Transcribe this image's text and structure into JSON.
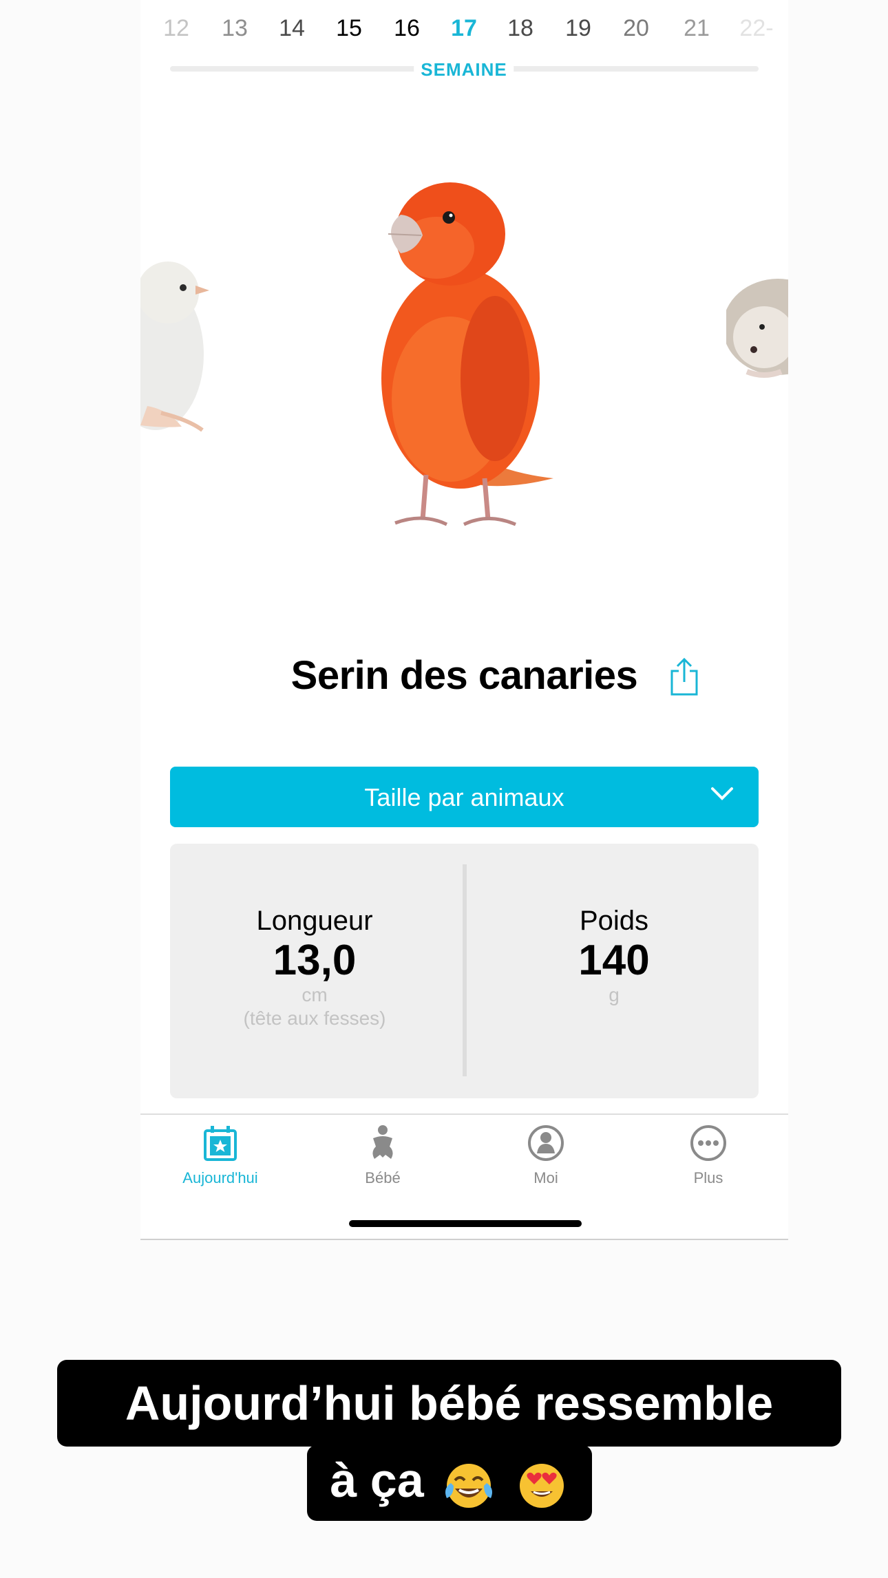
{
  "week_selector": {
    "weeks": [
      "12",
      "13",
      "14",
      "15",
      "16",
      "17",
      "18",
      "19",
      "20",
      "21",
      "22-"
    ],
    "active_week": "17",
    "label": "SEMAINE"
  },
  "animal": {
    "name": "Serin des canaries"
  },
  "size_dropdown": {
    "label": "Taille par animaux"
  },
  "stats": {
    "length": {
      "label": "Longueur",
      "value": "13,0",
      "unit": "cm",
      "note": "(tête aux fesses)"
    },
    "weight": {
      "label": "Poids",
      "value": "140",
      "unit": "g"
    }
  },
  "tabs": [
    {
      "label": "Aujourd'hui",
      "icon": "calendar-star-icon",
      "active": true
    },
    {
      "label": "Bébé",
      "icon": "baby-icon",
      "active": false
    },
    {
      "label": "Moi",
      "icon": "bell-person-icon",
      "active": false
    },
    {
      "label": "Plus",
      "icon": "more-dots-icon",
      "active": false
    }
  ],
  "caption": {
    "line1": "Aujourd’hui bébé ressemble",
    "line2": "à ça"
  },
  "colors": {
    "accent": "#19b6d6",
    "dropdown_bg": "#00bcdf",
    "canary": "#f2581e"
  }
}
